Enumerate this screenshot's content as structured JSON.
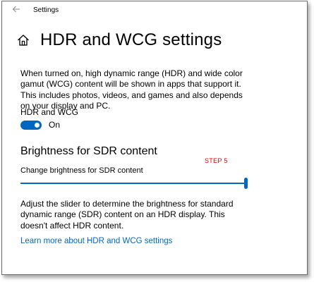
{
  "window": {
    "title": "Settings"
  },
  "header": {
    "title": "HDR and WCG settings",
    "icon": "home-icon"
  },
  "description": "When turned on, high dynamic range (HDR) and wide color gamut (WCG) content will be shown in apps that support it. This includes photos, videos, and games and also depends on your display and PC.",
  "hdr_toggle": {
    "label": "HDR and WCG",
    "state_text": "On",
    "on": true
  },
  "brightness": {
    "section_title": "Brightness for SDR content",
    "annotation": "STEP 5",
    "slider_label": "Change brightness for SDR content",
    "slider_value_fraction": 1.0,
    "help_text": "Adjust the slider to determine the brightness for standard dynamic range (SDR) content on an HDR display. This doesn't affect HDR content."
  },
  "link": {
    "text": "Learn more about HDR and WCG settings"
  },
  "colors": {
    "accent": "#0067c0",
    "annotation": "#e00000",
    "track": "#c8c8c8"
  }
}
